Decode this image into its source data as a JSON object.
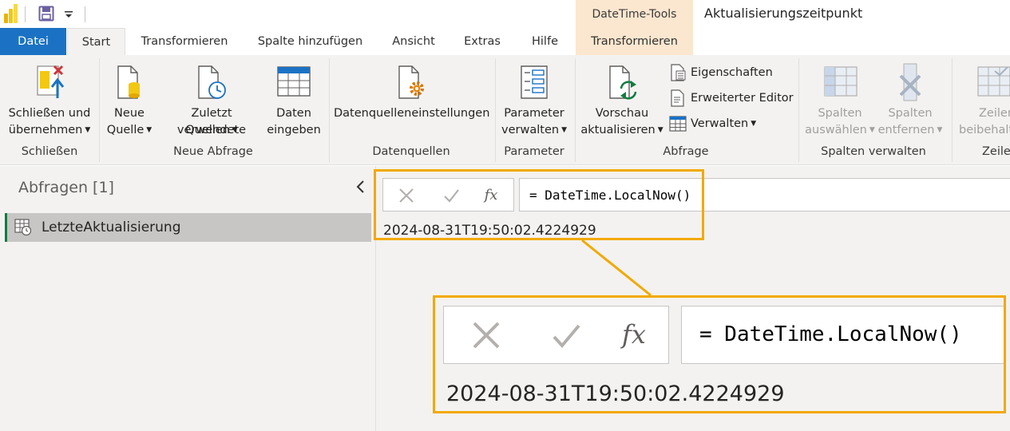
{
  "titlebar": {
    "context_header": "DateTime-Tools",
    "window_title": "Aktualisierungszeitpunkt",
    "icons": [
      "power-bi-logo",
      "save-icon",
      "customize-toolbar-icon"
    ]
  },
  "tabs": [
    "Datei",
    "Start",
    "Transformieren",
    "Spalte hinzufügen",
    "Ansicht",
    "Extras",
    "Hilfe",
    "Transformieren"
  ],
  "active_tab": "Start",
  "ribbon": {
    "groups": {
      "schliessen": {
        "label": "Schließen",
        "close_apply": {
          "line1": "Schließen und",
          "line2": "übernehmen"
        }
      },
      "neue_abfrage": {
        "label": "Neue Abfrage",
        "new_source": {
          "line1": "Neue",
          "line2": "Quelle"
        },
        "recent_sources": {
          "line1": "Zuletzt verwendete",
          "line2": "Quellen"
        },
        "enter_data": {
          "line1": "Daten",
          "line2": "eingeben"
        }
      },
      "datenquellen": {
        "label": "Datenquellen",
        "settings": "Datenquelleneinstellungen"
      },
      "parameter": {
        "label": "Parameter",
        "manage": {
          "line1": "Parameter",
          "line2": "verwalten"
        }
      },
      "abfrage": {
        "label": "Abfrage",
        "refresh_preview": {
          "line1": "Vorschau",
          "line2": "aktualisieren"
        },
        "properties": "Eigenschaften",
        "advanced_editor": "Erweiterter Editor",
        "manage": "Verwalten"
      },
      "spalten": {
        "label": "Spalten verwalten",
        "choose": {
          "line1": "Spalten",
          "line2": "auswählen"
        },
        "remove": {
          "line1": "Spalten",
          "line2": "entfernen"
        }
      },
      "zeilen": {
        "label": "Zeilen",
        "keep": {
          "line1": "Zeilen",
          "line2": "beibehalten"
        }
      }
    }
  },
  "queries": {
    "title": "Abfragen [1]",
    "items": [
      {
        "name": "LetzteAktualisierung"
      }
    ]
  },
  "formula": {
    "text": "= DateTime.LocalNow()",
    "fx_label": "fx"
  },
  "result": {
    "value": "2024-08-31T19:50:02.4224929"
  },
  "colors": {
    "file_tab": "#1b72c4",
    "context_tab": "#fbe6cf",
    "highlight": "#f2a900",
    "pane_bg": "#f3f2f1",
    "selected_query": "#c8c6c4"
  }
}
